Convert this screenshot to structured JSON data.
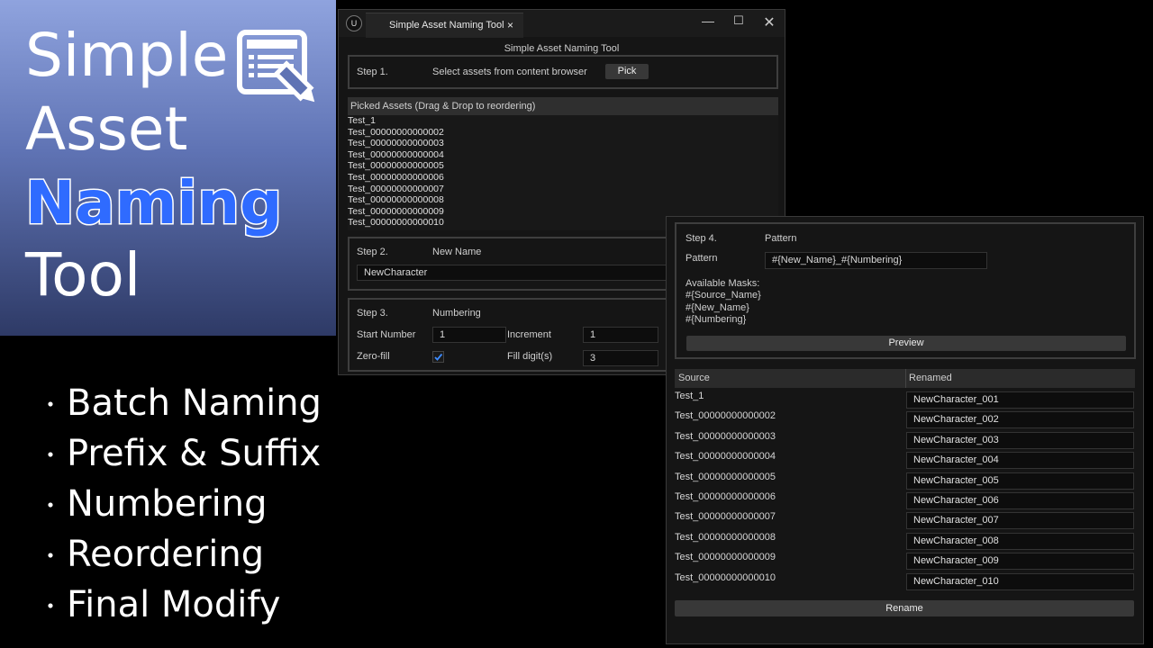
{
  "promo": {
    "title_lines": [
      "Simple",
      "Asset",
      "Naming",
      "Tool"
    ],
    "features": [
      "Batch Naming",
      "Prefix & Suffix",
      "Numbering",
      "Reordering",
      "Final Modify"
    ],
    "bullet": "・"
  },
  "window1": {
    "tab_title": "Simple Asset Naming Tool",
    "tab_close": "×",
    "controls": {
      "minimize": "—",
      "maximize": "☐",
      "close": "✕"
    },
    "header_title": "Simple Asset Naming Tool",
    "step1": {
      "label": "Step 1.",
      "instruction": "Select assets from content browser",
      "pick_button": "Pick"
    },
    "picked_assets_header": "Picked Assets (Drag & Drop to reordering)",
    "picked_assets": [
      "Test_1",
      "Test_00000000000002",
      "Test_00000000000003",
      "Test_00000000000004",
      "Test_00000000000005",
      "Test_00000000000006",
      "Test_00000000000007",
      "Test_00000000000008",
      "Test_00000000000009",
      "Test_00000000000010"
    ],
    "step2": {
      "label": "Step 2.",
      "title": "New Name",
      "value": "NewCharacter"
    },
    "step3": {
      "label": "Step 3.",
      "title": "Numbering",
      "start_number_label": "Start Number",
      "start_number_value": "1",
      "increment_label": "Increment",
      "increment_value": "1",
      "zero_fill_label": "Zero-fill",
      "zero_fill_checked": true,
      "fill_digits_label": "Fill digit(s)",
      "fill_digits_value": "3"
    }
  },
  "window2": {
    "step4": {
      "label": "Step 4.",
      "title": "Pattern",
      "pattern_label": "Pattern",
      "pattern_value": "#{New_Name}_#{Numbering}",
      "masks_title": "Available Masks:",
      "masks": [
        "#{Source_Name}",
        "#{New_Name}",
        "#{Numbering}"
      ],
      "preview_button": "Preview"
    },
    "table": {
      "source_header": "Source",
      "renamed_header": "Renamed",
      "rows": [
        {
          "source": "Test_1",
          "renamed": "NewCharacter_001"
        },
        {
          "source": "Test_00000000000002",
          "renamed": "NewCharacter_002"
        },
        {
          "source": "Test_00000000000003",
          "renamed": "NewCharacter_003"
        },
        {
          "source": "Test_00000000000004",
          "renamed": "NewCharacter_004"
        },
        {
          "source": "Test_00000000000005",
          "renamed": "NewCharacter_005"
        },
        {
          "source": "Test_00000000000006",
          "renamed": "NewCharacter_006"
        },
        {
          "source": "Test_00000000000007",
          "renamed": "NewCharacter_007"
        },
        {
          "source": "Test_00000000000008",
          "renamed": "NewCharacter_008"
        },
        {
          "source": "Test_00000000000009",
          "renamed": "NewCharacter_009"
        },
        {
          "source": "Test_00000000000010",
          "renamed": "NewCharacter_010"
        }
      ]
    },
    "rename_button": "Rename"
  },
  "colors": {
    "accent_blue": "#2f6bff",
    "checkbox_blue": "#3d8bff",
    "window_bg": "#151515",
    "promo_gradient_top": "#8fa3de",
    "promo_gradient_bottom": "#2e3a66"
  }
}
